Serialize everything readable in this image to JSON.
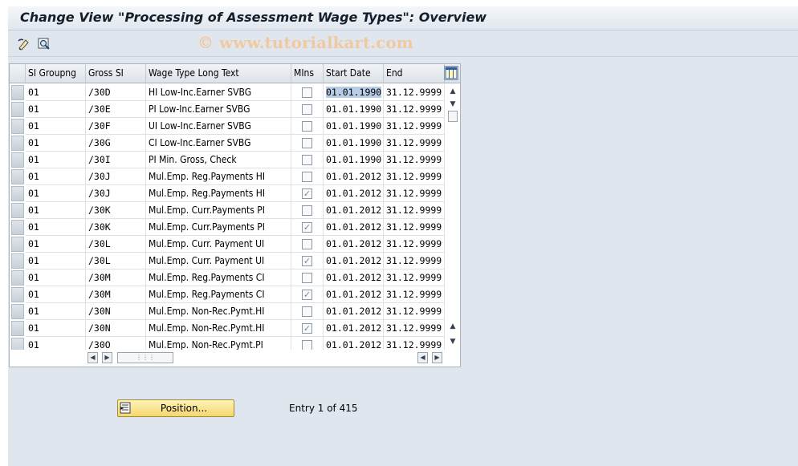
{
  "window": {
    "title": "Change View \"Processing of Assessment Wage Types\": Overview",
    "watermark": "© www.tutorialkart.com"
  },
  "toolbar": {
    "buttons": [
      {
        "icon": "display-change-icon"
      },
      {
        "icon": "find-icon"
      }
    ]
  },
  "table": {
    "columns": [
      "SI Groupng",
      "Gross SI",
      "Wage Type Long Text",
      "MIns",
      "Start Date",
      "End"
    ],
    "rows": [
      {
        "group": "01",
        "gross": "/30D",
        "text": "HI Low-Inc.Earner  SVBG",
        "mins": false,
        "start": "01.01.1990",
        "end": "31.12.9999"
      },
      {
        "group": "01",
        "gross": "/30E",
        "text": "PI Low-Inc.Earner  SVBG",
        "mins": false,
        "start": "01.01.1990",
        "end": "31.12.9999"
      },
      {
        "group": "01",
        "gross": "/30F",
        "text": "UI Low-Inc.Earner SVBG",
        "mins": false,
        "start": "01.01.1990",
        "end": "31.12.9999"
      },
      {
        "group": "01",
        "gross": "/30G",
        "text": "CI Low-Inc.Earner SVBG",
        "mins": false,
        "start": "01.01.1990",
        "end": "31.12.9999"
      },
      {
        "group": "01",
        "gross": "/30I",
        "text": "PI Min. Gross, Check",
        "mins": false,
        "start": "01.01.1990",
        "end": "31.12.9999"
      },
      {
        "group": "01",
        "gross": "/30J",
        "text": "Mul.Emp. Reg.Payments HI",
        "mins": false,
        "start": "01.01.2012",
        "end": "31.12.9999"
      },
      {
        "group": "01",
        "gross": "/30J",
        "text": "Mul.Emp. Reg.Payments HI",
        "mins": true,
        "start": "01.01.2012",
        "end": "31.12.9999"
      },
      {
        "group": "01",
        "gross": "/30K",
        "text": "Mul.Emp. Curr.Payments PI",
        "mins": false,
        "start": "01.01.2012",
        "end": "31.12.9999"
      },
      {
        "group": "01",
        "gross": "/30K",
        "text": "Mul.Emp. Curr.Payments PI",
        "mins": true,
        "start": "01.01.2012",
        "end": "31.12.9999"
      },
      {
        "group": "01",
        "gross": "/30L",
        "text": "Mul.Emp. Curr. Payment UI",
        "mins": false,
        "start": "01.01.2012",
        "end": "31.12.9999"
      },
      {
        "group": "01",
        "gross": "/30L",
        "text": "Mul.Emp. Curr. Payment UI",
        "mins": true,
        "start": "01.01.2012",
        "end": "31.12.9999"
      },
      {
        "group": "01",
        "gross": "/30M",
        "text": "Mul.Emp. Reg.Payments CI",
        "mins": false,
        "start": "01.01.2012",
        "end": "31.12.9999"
      },
      {
        "group": "01",
        "gross": "/30M",
        "text": "Mul.Emp. Reg.Payments CI",
        "mins": true,
        "start": "01.01.2012",
        "end": "31.12.9999"
      },
      {
        "group": "01",
        "gross": "/30N",
        "text": "Mul.Emp. Non-Rec.Pymt.HI",
        "mins": false,
        "start": "01.01.2012",
        "end": "31.12.9999"
      },
      {
        "group": "01",
        "gross": "/30N",
        "text": "Mul.Emp. Non-Rec.Pymt.HI",
        "mins": true,
        "start": "01.01.2012",
        "end": "31.12.9999"
      },
      {
        "group": "01",
        "gross": "/30O",
        "text": "Mul.Emp. Non-Rec.Pymt.PI",
        "mins": false,
        "start": "01.01.2012",
        "end": "31.12.9999"
      }
    ]
  },
  "footer": {
    "position_button": "Position...",
    "entry_info": "Entry 1 of 415"
  },
  "colors": {
    "selection": "#b7cde6",
    "button": "#f5d76e"
  }
}
